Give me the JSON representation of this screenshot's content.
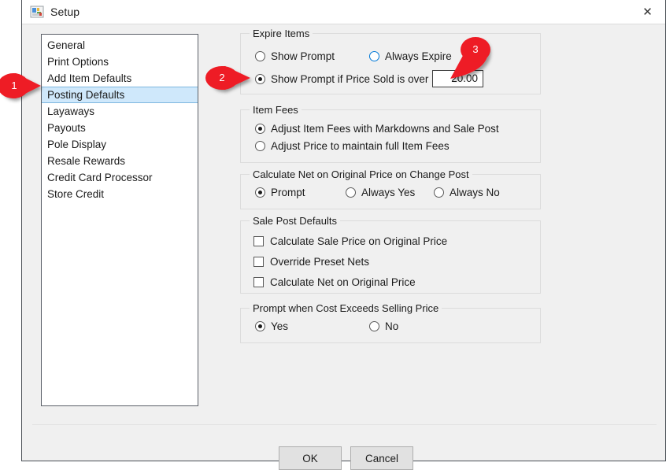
{
  "window": {
    "title": "Setup",
    "app_icon": "setup-app-icon",
    "close_label": "✕"
  },
  "sidebar": {
    "items": [
      {
        "label": "General",
        "selected": false
      },
      {
        "label": "Print Options",
        "selected": false
      },
      {
        "label": "Add Item Defaults",
        "selected": false
      },
      {
        "label": "Posting Defaults",
        "selected": true
      },
      {
        "label": "Layaways",
        "selected": false
      },
      {
        "label": "Payouts",
        "selected": false
      },
      {
        "label": "Pole Display",
        "selected": false
      },
      {
        "label": "Resale Rewards",
        "selected": false
      },
      {
        "label": "Credit Card Processor",
        "selected": false
      },
      {
        "label": "Store Credit",
        "selected": false
      }
    ]
  },
  "groups": {
    "expire_items": {
      "legend": "Expire Items",
      "opt_show_prompt": "Show Prompt",
      "opt_always_expire": "Always Expire",
      "opt_show_prompt_over": "Show Prompt if Price Sold is over",
      "price_value": "20.00"
    },
    "item_fees": {
      "legend": "Item Fees",
      "opt_adjust_fees": "Adjust Item Fees with Markdowns and Sale Post",
      "opt_adjust_price": "Adjust Price to maintain full Item Fees"
    },
    "calculate_net": {
      "legend": "Calculate Net on Original Price on Change Post",
      "opt_prompt": "Prompt",
      "opt_always_yes": "Always Yes",
      "opt_always_no": "Always No"
    },
    "sale_post_defaults": {
      "legend": "Sale Post Defaults",
      "chk_calc_sale_price": "Calculate Sale Price on Original Price",
      "chk_override_nets": "Override Preset Nets",
      "chk_calc_net": "Calculate Net on Original Price"
    },
    "cost_exceeds": {
      "legend": "Prompt when Cost Exceeds Selling Price",
      "opt_yes": "Yes",
      "opt_no": "No"
    }
  },
  "footer": {
    "ok_label": "OK",
    "cancel_label": "Cancel"
  },
  "callouts": [
    {
      "number": "1"
    },
    {
      "number": "2"
    },
    {
      "number": "3"
    }
  ],
  "colors": {
    "callout_red": "#ee1c25",
    "selection_blue": "#cfe8fb",
    "accent_blue": "#0078d7",
    "dialog_bg": "#f0f0f0"
  }
}
